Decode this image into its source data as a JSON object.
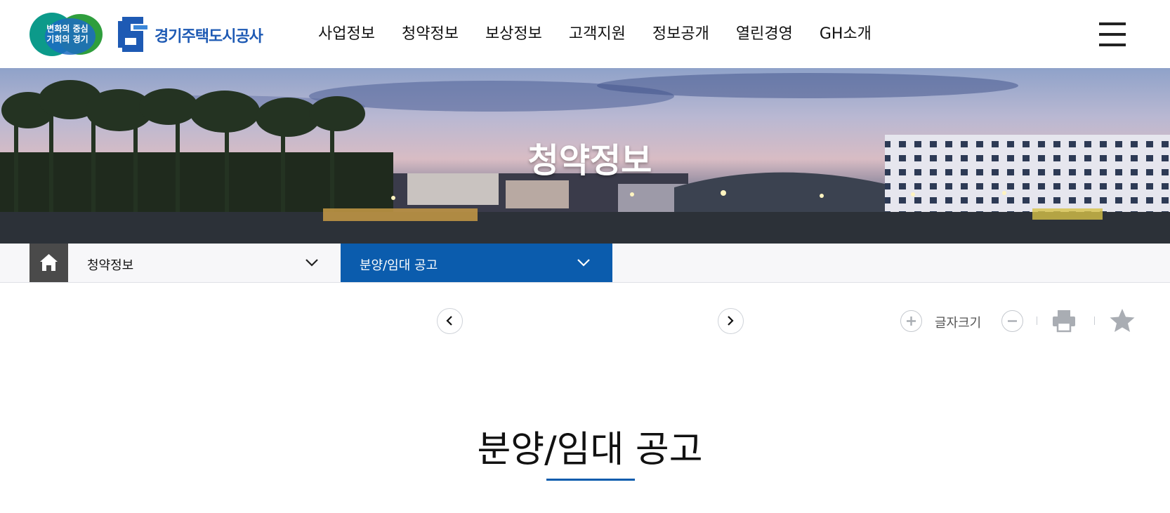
{
  "colors": {
    "primary_blue": "#0b5cad",
    "brand_blue": "#1e5ab4",
    "home_gray": "#4a4a4a",
    "dot_colors": [
      "#e23b3b",
      "#2fa04a",
      "#e2663b",
      "#2b6ec9"
    ]
  },
  "header": {
    "badge_line1": "변화의 중심",
    "badge_line2": "기회의 경기",
    "brand_name": "경기주택도시공사",
    "nav": [
      "사업정보",
      "청약정보",
      "보상정보",
      "고객지원",
      "정보공개",
      "열린경영",
      "GH소개"
    ],
    "menu_icon": "hamburger-menu-icon"
  },
  "hero": {
    "title": "청약정보"
  },
  "subnav": {
    "home_icon": "home-icon",
    "depth1_label": "청약정보",
    "depth2_label": "분양/임대 공고",
    "chevron_icon": "chevron-down-icon"
  },
  "tools": {
    "prev_icon": "chevron-left-icon",
    "next_icon": "chevron-right-icon",
    "font_size_label": "글자크기",
    "font_plus_icon": "plus-circle-icon",
    "font_minus_icon": "minus-circle-icon",
    "print_icon": "print-icon",
    "bookmark_icon": "star-icon"
  },
  "content": {
    "title": "분양/임대 공고"
  }
}
